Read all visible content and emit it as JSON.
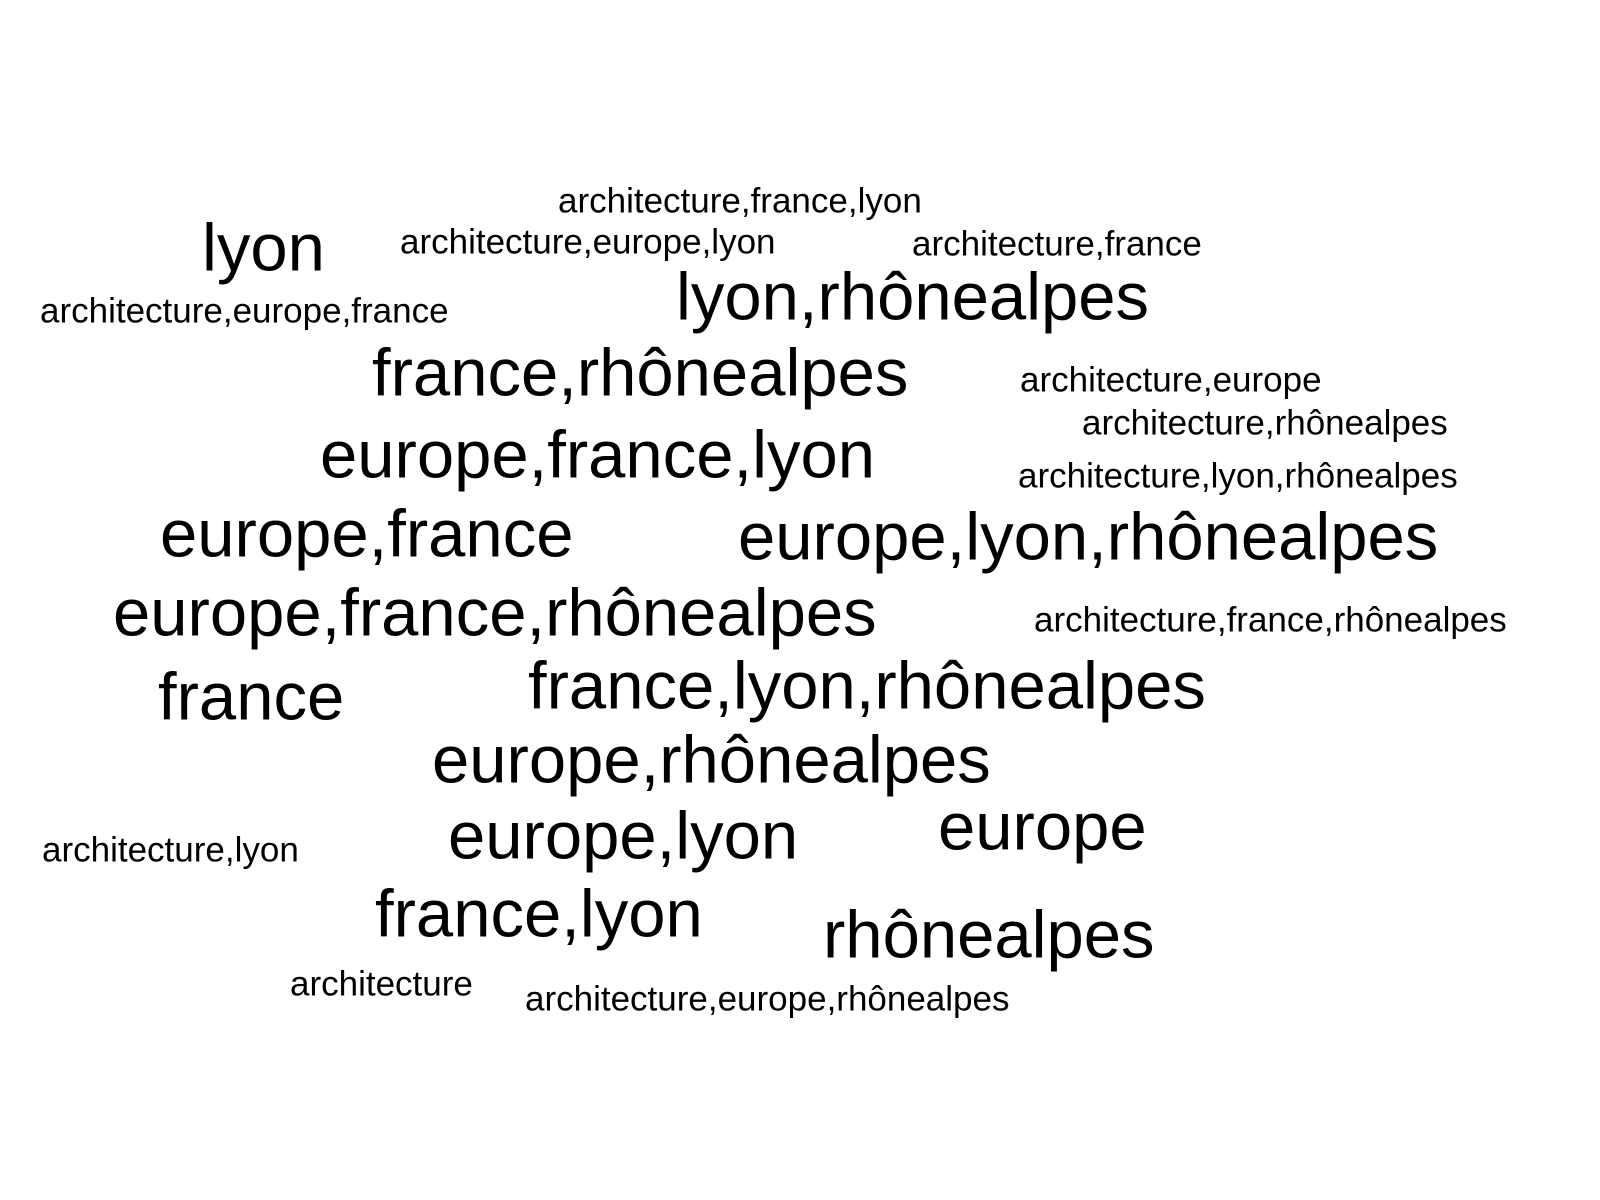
{
  "word_cloud": {
    "text_color": "#000000",
    "background": "#ffffff",
    "words": [
      {
        "text": "architecture,france,lyon",
        "weight": 1
      },
      {
        "text": "lyon",
        "weight": 3
      },
      {
        "text": "architecture,europe,lyon",
        "weight": 1
      },
      {
        "text": "architecture,france",
        "weight": 1
      },
      {
        "text": "lyon,rhônealpes",
        "weight": 3
      },
      {
        "text": "architecture,europe,france",
        "weight": 1
      },
      {
        "text": "france,rhônealpes",
        "weight": 3
      },
      {
        "text": "architecture,europe",
        "weight": 1
      },
      {
        "text": "architecture,rhônealpes",
        "weight": 1
      },
      {
        "text": "europe,france,lyon",
        "weight": 3
      },
      {
        "text": "architecture,lyon,rhônealpes",
        "weight": 1
      },
      {
        "text": "europe,france",
        "weight": 3
      },
      {
        "text": "europe,lyon,rhônealpes",
        "weight": 3
      },
      {
        "text": "europe,france,rhônealpes",
        "weight": 3
      },
      {
        "text": "architecture,france,rhônealpes",
        "weight": 1
      },
      {
        "text": "france",
        "weight": 3
      },
      {
        "text": "france,lyon,rhônealpes",
        "weight": 3
      },
      {
        "text": "europe,rhônealpes",
        "weight": 3
      },
      {
        "text": "architecture,lyon",
        "weight": 1
      },
      {
        "text": "europe,lyon",
        "weight": 3
      },
      {
        "text": "europe",
        "weight": 3
      },
      {
        "text": "france,lyon",
        "weight": 3
      },
      {
        "text": "rhônealpes",
        "weight": 3
      },
      {
        "text": "architecture",
        "weight": 1
      },
      {
        "text": "architecture,europe,rhônealpes",
        "weight": 1
      }
    ]
  }
}
